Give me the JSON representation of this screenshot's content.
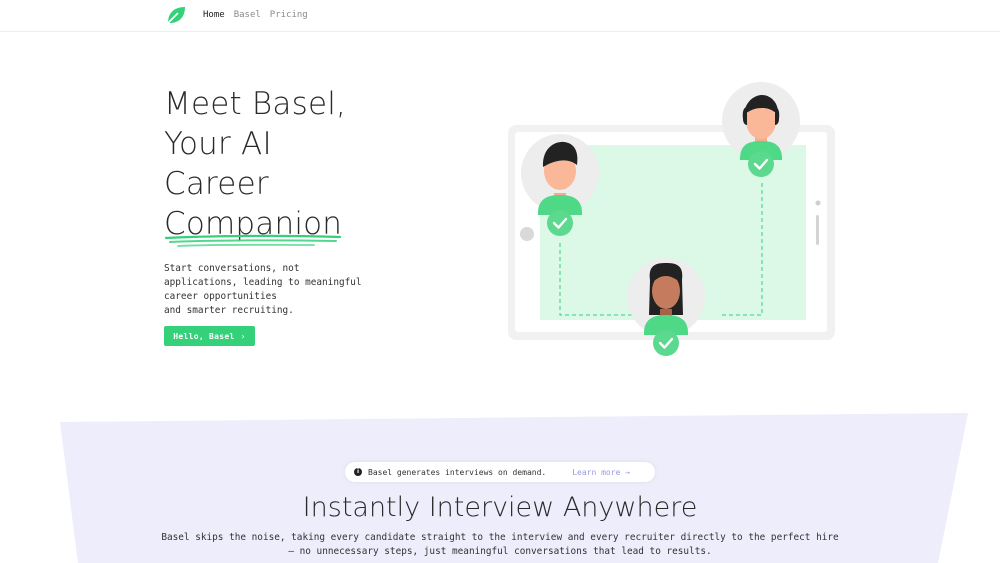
{
  "nav": {
    "links": [
      {
        "label": "Home",
        "active": true
      },
      {
        "label": "Basel",
        "active": false
      },
      {
        "label": "Pricing",
        "active": false
      }
    ]
  },
  "hero": {
    "title_lines": [
      "Meet Basel,",
      "Your AI",
      "Career",
      "Companion"
    ],
    "description_lines": [
      "Start conversations, not",
      "applications, leading to meaningful",
      "career opportunities",
      "and smarter recruiting."
    ],
    "cta_label": "Hello, Basel",
    "cta_arrow": "›"
  },
  "banner": {
    "icon": "info-icon",
    "text": "Basel generates interviews on demand.",
    "link_label": "Learn more →"
  },
  "section": {
    "title": "Instantly Interview Anywhere",
    "description": "Basel skips the noise, taking every candidate straight to the interview and every recruiter directly to the perfect hire — no unnecessary steps, just meaningful conversations that lead to results."
  },
  "colors": {
    "brand_green": "#34d07a",
    "light_green": "#dcf8e6",
    "lavender": "#ededfb",
    "link_lavender": "#9a9ae0"
  }
}
